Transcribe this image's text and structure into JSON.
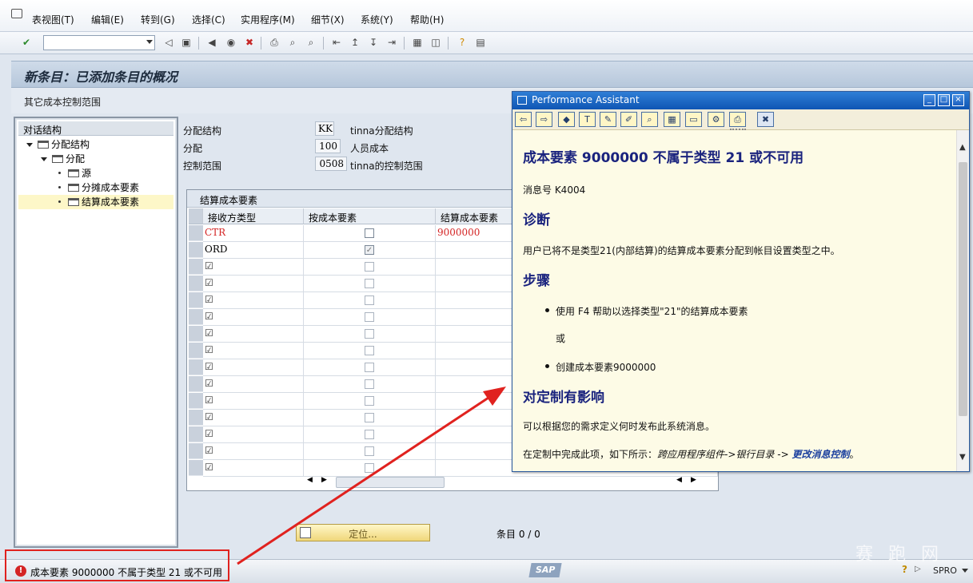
{
  "menu": {
    "items": [
      "表视图(T)",
      "编辑(E)",
      "转到(G)",
      "选择(C)",
      "实用程序(M)",
      "细节(X)",
      "系统(Y)",
      "帮助(H)"
    ]
  },
  "toolbar": {
    "command_value": "",
    "icons": [
      "enter-icon",
      "back-icon",
      "save-icon",
      "exit-icon",
      "cancel-icon",
      "print-icon",
      "find-icon",
      "find-next-icon",
      "first-page-icon",
      "prev-page-icon",
      "next-page-icon",
      "last-page-icon",
      "layout-icon",
      "generate-shortcut-icon",
      "help-icon",
      "customize-icon"
    ]
  },
  "screen": {
    "title": "新条目：已添加条目的概况",
    "app_button": "其它成本控制范围"
  },
  "tree": {
    "header": "对话结构",
    "items": [
      {
        "label": "分配结构",
        "level": 1,
        "expanded": true
      },
      {
        "label": "分配",
        "level": 2,
        "expanded": true
      },
      {
        "label": "源",
        "level": 3
      },
      {
        "label": "分摊成本要素",
        "level": 3
      },
      {
        "label": "结算成本要素",
        "level": 3,
        "selected": true
      }
    ]
  },
  "fields": [
    {
      "label": "分配结构",
      "value": "KK",
      "desc": "tinna分配结构"
    },
    {
      "label": "分配",
      "value": "100",
      "desc": "人员成本"
    },
    {
      "label": "控制范围",
      "value": "0508",
      "desc": "tinna的控制范围"
    }
  ],
  "table": {
    "caption": "结算成本要素",
    "columns": [
      "接收方类型",
      "按成本要素",
      "结算成本要素"
    ],
    "rows": [
      {
        "receiver": "CTR",
        "by_element": false,
        "element": "9000000",
        "error": true
      },
      {
        "receiver": "ORD",
        "by_element": true,
        "element": "",
        "error": false
      }
    ],
    "empty_rows": 13,
    "empty_row_mark": "☑"
  },
  "footer": {
    "locate_button": "定位...",
    "entries": "条目 0 / 0"
  },
  "status": {
    "message": "成本要素 9000000 不属于类型 21 或不可用",
    "logo": "SAP",
    "system": "SPRO",
    "watermark": "赛 跑 网"
  },
  "assistant": {
    "title": "Performance Assistant",
    "heading": "成本要素 9000000 不属于类型 21 或不可用",
    "msg_no": "消息号 K4004",
    "diag_title": "诊断",
    "diag_text": "用户已将不是类型21(内部结算)的结算成本要素分配到帐目设置类型之中。",
    "proc_title": "步骤",
    "proc_item1": "使用 F4 帮助以选择类型\"21\"的结算成本要素",
    "proc_or": "或",
    "proc_item2": "创建成本要素9000000",
    "impact_title": "对定制有影响",
    "impact_text": "可以根据您的需求定义何时发布此系统消息。",
    "path_prefix": "在定制中完成此项，如下所示：",
    "path_1": "跨应用程序组件->",
    "path_2": "银行目录",
    "path_sep": " -> ",
    "path_link": "更改消息控制",
    "path_end": "。"
  },
  "colors": {
    "error_red": "#d42424",
    "annotation_red": "#e0221f",
    "assistant_heading": "#1a237e",
    "titlebar_blue": "#0f55b4"
  }
}
